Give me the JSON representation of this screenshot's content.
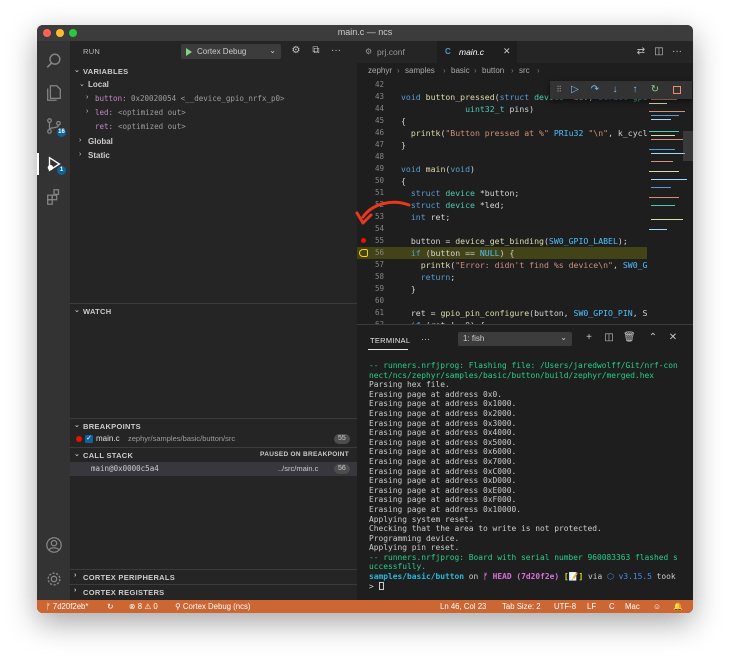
{
  "window": {
    "title": "main.c — ncs"
  },
  "activity_bar": {
    "scm_badge": "16",
    "debug_badge": "1"
  },
  "sidebar": {
    "run_label": "RUN",
    "config_name": "Cortex Debug",
    "variables": {
      "header": "VARIABLES",
      "local_label": "Local",
      "items": [
        {
          "name": "button:",
          "value": "0x20020054 <__device_gpio_nrfx_p0>"
        },
        {
          "name": "led:",
          "value": "<optimized out>"
        },
        {
          "name": "ret:",
          "value": "<optimized out>"
        }
      ],
      "global_label": "Global",
      "static_label": "Static"
    },
    "watch": {
      "header": "WATCH"
    },
    "breakpoints": {
      "header": "BREAKPOINTS",
      "item_file": "main.c",
      "item_path": "zephyr/samples/basic/button/src",
      "item_line": "55"
    },
    "call_stack": {
      "header": "CALL STACK",
      "status": "PAUSED ON BREAKPOINT",
      "frame_name": "main@0x0000c5a4",
      "frame_file": "../src/main.c",
      "frame_line": "56"
    },
    "cortex_peripherals": "CORTEX PERIPHERALS",
    "cortex_registers": "CORTEX REGISTERS"
  },
  "editor": {
    "tabs": [
      {
        "label": "prj.conf",
        "icon": "gear"
      },
      {
        "label": "main.c",
        "icon": "C"
      }
    ],
    "breadcrumb": [
      "zephyr",
      "samples",
      "basic",
      "button",
      "src"
    ],
    "lines": [
      {
        "n": "42",
        "code": ""
      },
      {
        "n": "43",
        "code": "void button_pressed(struct device *dev, struct gpi"
      },
      {
        "n": "44",
        "code": "             uint32_t pins)"
      },
      {
        "n": "45",
        "code": "{"
      },
      {
        "n": "46",
        "code": "  printk(\"Button pressed at %\" PRIu32 \"\\n\", k_cycl"
      },
      {
        "n": "47",
        "code": "}"
      },
      {
        "n": "48",
        "code": ""
      },
      {
        "n": "49",
        "code": "void main(void)"
      },
      {
        "n": "50",
        "code": "{"
      },
      {
        "n": "51",
        "code": "  struct device *button;"
      },
      {
        "n": "52",
        "code": "  struct device *led;"
      },
      {
        "n": "53",
        "code": "  int ret;"
      },
      {
        "n": "54",
        "code": ""
      },
      {
        "n": "55",
        "code": "  button = device_get_binding(SW0_GPIO_LABEL);"
      },
      {
        "n": "56",
        "code": "  if (button == NULL) {"
      },
      {
        "n": "57",
        "code": "    printk(\"Error: didn't find %s device\\n\", SW0_G"
      },
      {
        "n": "58",
        "code": "    return;"
      },
      {
        "n": "59",
        "code": "  }"
      },
      {
        "n": "60",
        "code": ""
      },
      {
        "n": "61",
        "code": "  ret = gpio_pin_configure(button, SW0_GPIO_PIN, S"
      },
      {
        "n": "62",
        "code": "  if (ret != 0) {"
      }
    ]
  },
  "panel": {
    "title": "TERMINAL",
    "terminal_select": "1: fish",
    "output": [
      "-- runners.nrfjprog: Flashing file: /Users/jaredwolff/Git/nrf-con",
      "nect/ncs/zephyr/samples/basic/button/build/zephyr/merged.hex",
      "Parsing hex file.",
      "Erasing page at address 0x0.",
      "Erasing page at address 0x1000.",
      "Erasing page at address 0x2000.",
      "Erasing page at address 0x3000.",
      "Erasing page at address 0x4000.",
      "Erasing page at address 0x5000.",
      "Erasing page at address 0x6000.",
      "Erasing page at address 0x7000.",
      "Erasing page at address 0xC000.",
      "Erasing page at address 0xD000.",
      "Erasing page at address 0xE000.",
      "Erasing page at address 0xF000.",
      "Erasing page at address 0x10000.",
      "Applying system reset.",
      "Checking that the area to write is not protected.",
      "Programming device.",
      "Applying pin reset.",
      "-- runners.nrfjprog: Board with serial number 960083363 flashed s",
      "uccessfully."
    ],
    "prompt": {
      "path": "samples/basic/button",
      "on": "on",
      "branch": "HEAD",
      "hash": "(7d20f2e)",
      "flag": "[📝]",
      "via": "via",
      "version": "v3.15.5",
      "took": "took",
      "caret": ">"
    }
  },
  "statusbar": {
    "branch": "7d20f2eb*",
    "errors": "8",
    "warnings": "0",
    "debug": "Cortex Debug (ncs)",
    "position": "Ln 46, Col 23",
    "tab_size": "Tab Size: 2",
    "encoding": "UTF-8",
    "eol": "LF",
    "language": "C",
    "platform": "Mac"
  },
  "colors": {
    "status_bar": "#cc6633",
    "accent": "#0e639c",
    "breakpoint": "#e51400"
  }
}
